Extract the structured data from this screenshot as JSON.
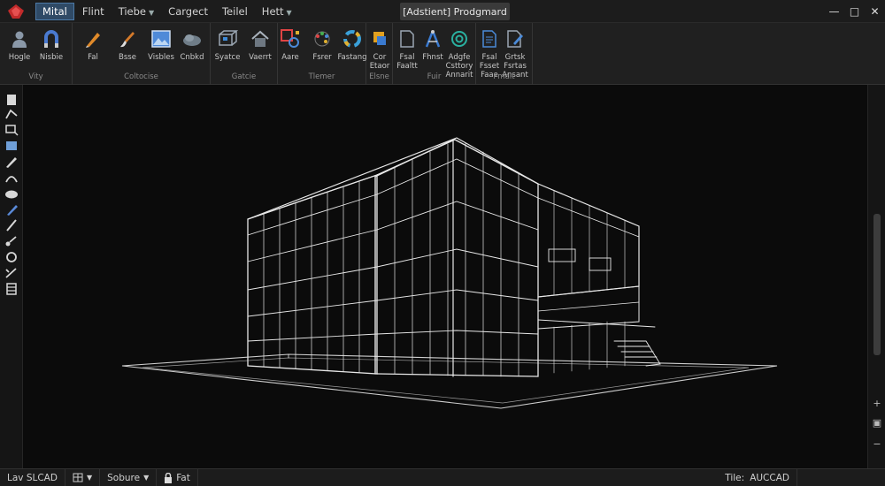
{
  "menu": [
    {
      "label": "Mital",
      "active": true
    },
    {
      "label": "Flint"
    },
    {
      "label": "Tiebe",
      "caret": true
    },
    {
      "label": "Cargect"
    },
    {
      "label": "Teilel"
    },
    {
      "label": "Hett",
      "caret": true
    }
  ],
  "window_title": "[Adstient] Prodgmard",
  "window_controls": {
    "minimize": "—",
    "maximize": "□",
    "close": "✕"
  },
  "ribbon": {
    "panels": [
      {
        "label": "Vity",
        "tools": [
          {
            "label": "Hogle",
            "icon": "person-icon"
          },
          {
            "label": "Nisbie",
            "icon": "magnet-icon"
          }
        ]
      },
      {
        "label": "Coltocise",
        "tools": [
          {
            "label": "Fal",
            "icon": "pencil-icon"
          },
          {
            "label": "Bsse",
            "icon": "brush-icon"
          },
          {
            "label": "Visbles",
            "icon": "image-icon"
          },
          {
            "label": "Cnbkd",
            "icon": "cloud-icon"
          }
        ]
      },
      {
        "label": "Gatcie",
        "tools": [
          {
            "label": "Syatce",
            "icon": "cube-icon"
          },
          {
            "label": "Vaerrt",
            "icon": "house-icon"
          }
        ]
      },
      {
        "label": "Tlemer",
        "tools": [
          {
            "label": "Aare",
            "icon": "shapes-icon"
          },
          {
            "label": "Fsrer",
            "icon": "palette-icon"
          },
          {
            "label": "Fastang",
            "icon": "color-wheel-icon"
          }
        ]
      },
      {
        "label": "Elsne",
        "tools": [
          {
            "label": "Cor\nEtaor",
            "icon": "fill-icon"
          }
        ]
      },
      {
        "label": "Fuir",
        "tools": [
          {
            "label": "Fsal\nFaaltt",
            "icon": "document-icon"
          },
          {
            "label": "Fhnst",
            "icon": "compass-icon"
          },
          {
            "label": "Adgfe\nCsttory\nAnnarit",
            "icon": "target-icon"
          }
        ]
      },
      {
        "label": "Fmdit",
        "tools": [
          {
            "label": "Fsal\nFsset\nFaae",
            "icon": "sheet-icon"
          },
          {
            "label": "Grtsk\nFsrtas\nAnsant",
            "icon": "edit-sheet-icon"
          }
        ]
      }
    ]
  },
  "statusbar": {
    "model": "Lav SLCAD",
    "layout_icon": "grid-icon",
    "scale": "Sobure",
    "lock_label": "Fat",
    "title_label": "Tile:",
    "app_name": "AUCCAD"
  },
  "colors": {
    "accent": "#4c79a6",
    "logo": "#d0302e",
    "wire": "#e8e8e8"
  }
}
